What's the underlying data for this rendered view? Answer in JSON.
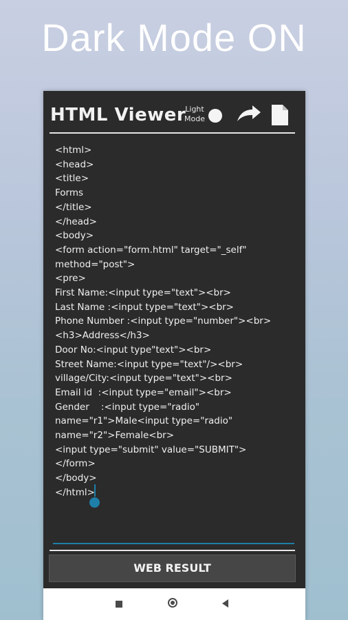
{
  "headline": "Dark Mode ON",
  "app": {
    "title": "HTML Viewer",
    "mode_label_line1": "Light",
    "mode_label_line2": "Mode",
    "share_icon": "share-arrow-icon",
    "file_icon": "document-icon"
  },
  "editor": {
    "lines": [
      "<html>",
      "<head>",
      "<title>",
      "Forms",
      "</title>",
      "</head>",
      "<body>",
      "<form action=\"form.html\" target=\"_self\"",
      "method=\"post\">",
      "<pre>",
      "First Name:<input type=\"text\"><br>",
      "Last Name :<input type=\"text\"><br>",
      "Phone Number :<input type=\"number\"><br>",
      "<h3>Address</h3>",
      "Door No:<input type\"text\"><br>",
      "Street Name:<input type=\"text\"/><br>",
      "village/City:<input type=\"text\"><br>",
      "Email id  :<input type=\"email\"><br>",
      "Gender    :<input type=\"radio\"",
      "name=\"r1\">Male<input type=\"radio\"",
      "name=\"r2\">Female<br>",
      "<input type=\"submit\" value=\"SUBMIT\">",
      "</form>",
      "</body>",
      "</html>"
    ]
  },
  "web_result_label": "WEB RESULT",
  "colors": {
    "panel": "#2b2b2b",
    "accent": "#1e7fa8",
    "text": "#f0f0f0"
  },
  "navbar": {
    "recents_icon": "square-icon",
    "home_icon": "circle-icon",
    "back_icon": "triangle-back-icon"
  }
}
